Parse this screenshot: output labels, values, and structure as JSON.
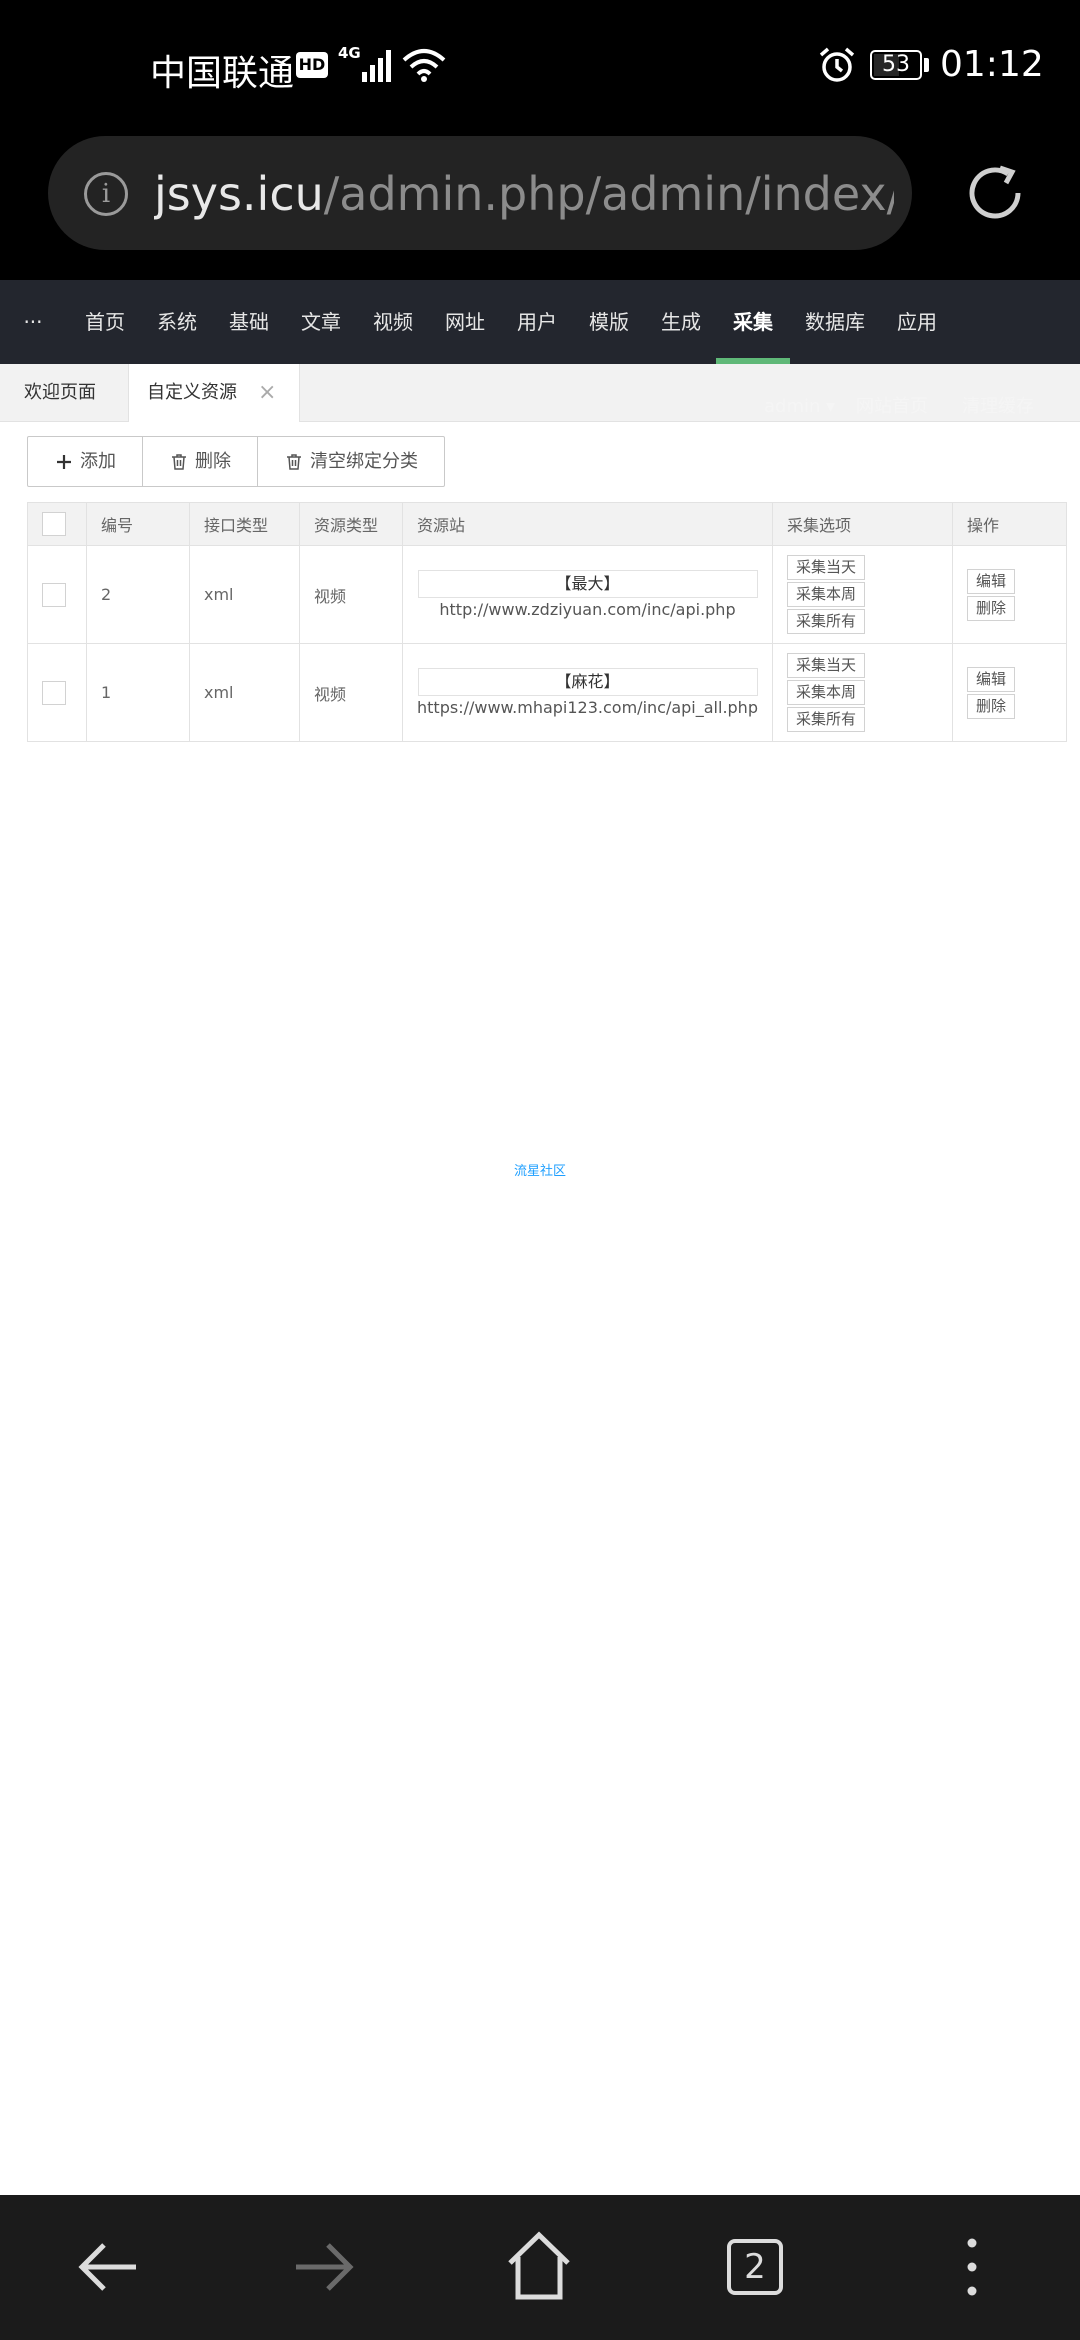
{
  "status_bar": {
    "carrier": "中国联通",
    "hd_badge": "HD",
    "network": "4G",
    "battery": "53",
    "battery_level_percent": 53,
    "time": "01:12"
  },
  "browser": {
    "url_host": "jsys.icu",
    "url_path": "/admin.php/admin/index/i"
  },
  "admin_nav": {
    "items": [
      "···",
      "首页",
      "系统",
      "基础",
      "文章",
      "视频",
      "网址",
      "用户",
      "模版",
      "生成",
      "采集",
      "数据库",
      "应用"
    ],
    "active": "采集"
  },
  "tabs": {
    "welcome": "欢迎页面",
    "current": "自定义资源",
    "close": "×",
    "right_user": "admin ▾",
    "right_home": "网站首页",
    "right_cache": "清理缓存"
  },
  "toolbar": {
    "add": "添加",
    "delete": "删除",
    "clear_binding": "清空绑定分类"
  },
  "table": {
    "headers": [
      "编号",
      "接口类型",
      "资源类型",
      "资源站",
      "采集选项",
      "操作"
    ],
    "rows": [
      {
        "id": "2",
        "api_type": "xml",
        "resource_type": "视频",
        "source_name": "【最大】",
        "source_url": "http://www.zdziyuan.com/inc/api.php",
        "collect_options": [
          "采集当天",
          "采集本周",
          "采集所有"
        ],
        "actions": [
          "编辑",
          "删除"
        ]
      },
      {
        "id": "1",
        "api_type": "xml",
        "resource_type": "视频",
        "source_name": "【麻花】",
        "source_url": "https://www.mhapi123.com/inc/api_all.php",
        "collect_options": [
          "采集当天",
          "采集本周",
          "采集所有"
        ],
        "actions": [
          "编辑",
          "删除"
        ]
      }
    ]
  },
  "footer": {
    "credit": "流星社区"
  },
  "bottom_nav": {
    "tab_count": "2"
  },
  "colors": {
    "nav_bg": "#23262e",
    "nav_active_underline": "#5fb878",
    "link_blue": "#1e9fff"
  }
}
